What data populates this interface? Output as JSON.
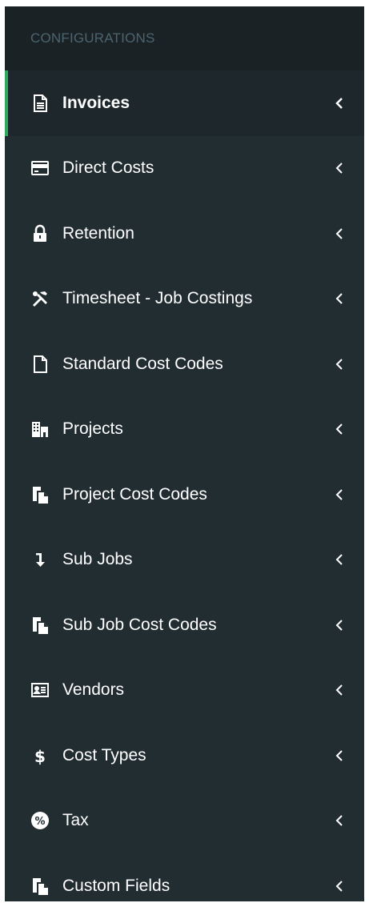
{
  "sidebar": {
    "header": "CONFIGURATIONS",
    "colors": {
      "background": "#222d32",
      "header_bg": "#1a2226",
      "active_bg": "#1e282c",
      "active_border": "#2eaa5c",
      "text": "#ffffff",
      "muted": "#4b646f"
    },
    "items": [
      {
        "label": "Invoices",
        "icon": "file-text-icon",
        "active": true
      },
      {
        "label": "Direct Costs",
        "icon": "credit-card-icon"
      },
      {
        "label": "Retention",
        "icon": "lock-icon"
      },
      {
        "label": "Timesheet - Job Costings",
        "icon": "tools-icon"
      },
      {
        "label": "Standard Cost Codes",
        "icon": "file-icon"
      },
      {
        "label": "Projects",
        "icon": "building-icon"
      },
      {
        "label": "Project Cost Codes",
        "icon": "copy-icon"
      },
      {
        "label": "Sub Jobs",
        "icon": "level-down-icon"
      },
      {
        "label": "Sub Job Cost Codes",
        "icon": "copy-icon"
      },
      {
        "label": "Vendors",
        "icon": "address-card-icon"
      },
      {
        "label": "Cost Types",
        "icon": "dollar-icon"
      },
      {
        "label": "Tax",
        "icon": "percent-icon"
      },
      {
        "label": "Custom Fields",
        "icon": "copy-icon"
      }
    ]
  }
}
